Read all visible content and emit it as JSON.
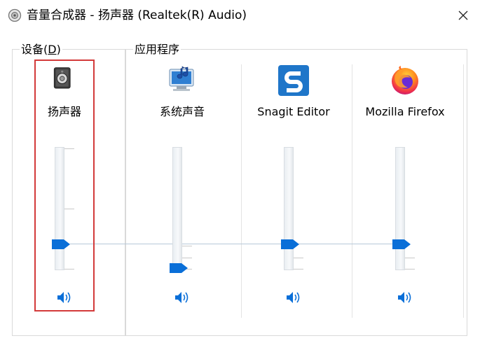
{
  "window": {
    "title": "音量合成器 - 扬声器 (Realtek(R) Audio)",
    "close_icon": "close-icon"
  },
  "groups": {
    "devices_label": "设备(D)",
    "devices_label_main": "设备(",
    "devices_label_key": "D",
    "devices_label_end": ")",
    "apps_label": "应用程序"
  },
  "channels": [
    {
      "name": "扬声器",
      "icon": "speaker-device-icon",
      "volume": 0.2,
      "muted": false
    },
    {
      "name": "系统声音",
      "icon": "system-sounds-icon",
      "volume": 0.0,
      "muted": false
    },
    {
      "name": "Snagit Editor",
      "icon": "snagit-icon",
      "volume": 0.2,
      "muted": false
    },
    {
      "name": "Mozilla Firefox",
      "icon": "firefox-icon",
      "volume": 0.2,
      "muted": false
    }
  ],
  "colors": {
    "accent": "#0a6fd8",
    "highlight_border": "#d33a3a",
    "frame": "#d9d9d9"
  }
}
